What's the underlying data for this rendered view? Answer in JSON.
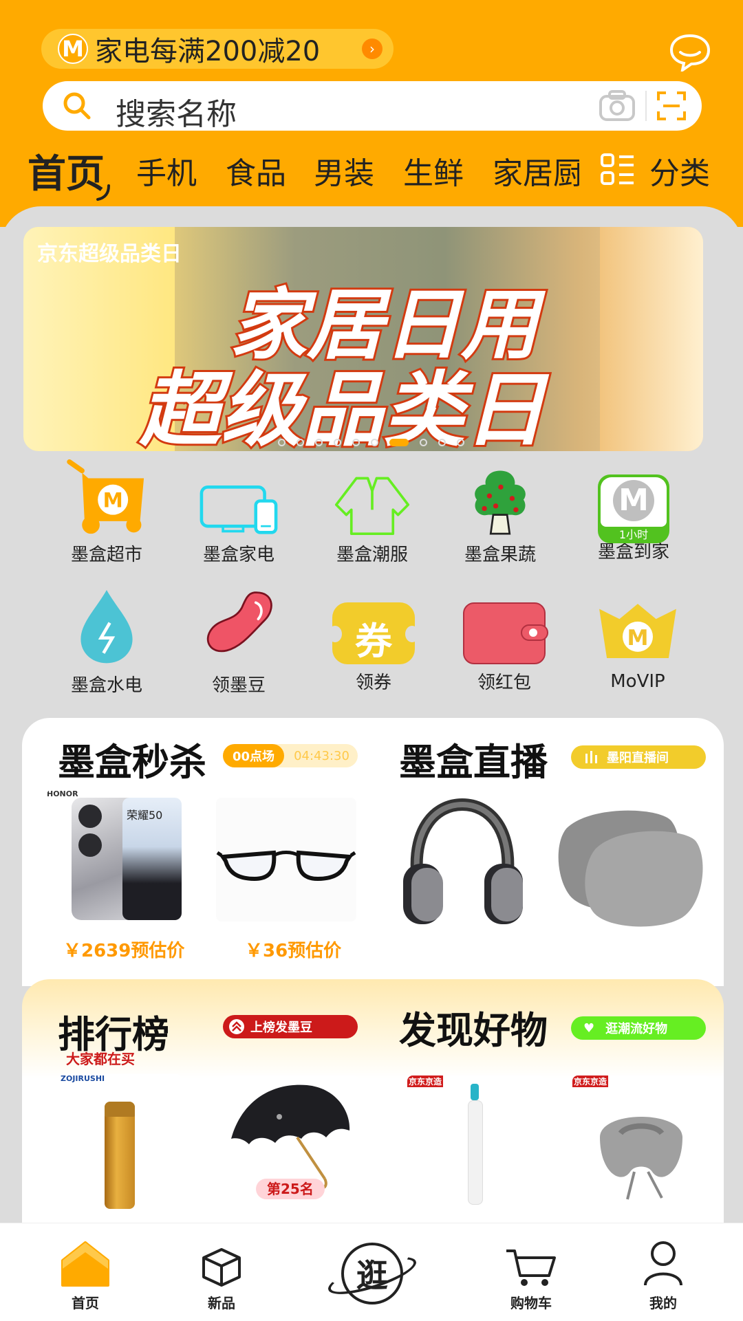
{
  "header": {
    "promo_text": "家电每满200减20",
    "promo_logo": "M",
    "search_placeholder": "搜索名称",
    "categories": [
      "首页",
      "手机",
      "食品",
      "男装",
      "生鲜",
      "家居厨"
    ],
    "category_all_label": "分类"
  },
  "banner": {
    "line1": "家居日用",
    "line2": "超级品类日",
    "logo_text": "京东超级品类日",
    "dots_total": 10,
    "dots_active_index": 6
  },
  "grid": [
    {
      "label": "墨盒超市",
      "icon": "cart-icon"
    },
    {
      "label": "墨盒家电",
      "icon": "devices-icon"
    },
    {
      "label": "墨盒潮服",
      "icon": "shirt-icon"
    },
    {
      "label": "墨盒果蔬",
      "icon": "tree-icon"
    },
    {
      "label": "墨盒到家",
      "icon": "delivery-icon",
      "badge": "1小时"
    },
    {
      "label": "墨盒水电",
      "icon": "water-drop-icon"
    },
    {
      "label": "领墨豆",
      "icon": "bean-icon"
    },
    {
      "label": "领券",
      "icon": "coupon-icon",
      "glyph": "券"
    },
    {
      "label": "领红包",
      "icon": "wallet-icon"
    },
    {
      "label": "MoVIP",
      "icon": "crown-icon",
      "glyph": "M"
    }
  ],
  "flash_sale": {
    "title": "墨盒秒杀",
    "session": "00点场",
    "countdown": "04:43:30",
    "items": [
      {
        "price": "￥2639预估价",
        "product_brand": "HONOR",
        "product_text": "荣耀50"
      },
      {
        "price": "￥36预估价"
      }
    ]
  },
  "live": {
    "title": "墨盒直播",
    "badge": "墨阳直播间"
  },
  "ranking": {
    "title": "排行榜",
    "badge": "上榜发墨豆",
    "subtitle": "大家都在买",
    "rank_tag": "第25名"
  },
  "discover": {
    "title": "发现好物",
    "badge": "逛潮流好物",
    "tag1": "京东京造",
    "tag2": "京东京造"
  },
  "tabbar": [
    {
      "label": "首页"
    },
    {
      "label": "新品"
    },
    {
      "label": "逛",
      "center": true
    },
    {
      "label": "购物车"
    },
    {
      "label": "我的"
    }
  ],
  "colors": {
    "accent": "#ffaa00",
    "red": "#cc1a1a",
    "green": "#4cd21a",
    "yellow": "#f2cc2b"
  }
}
